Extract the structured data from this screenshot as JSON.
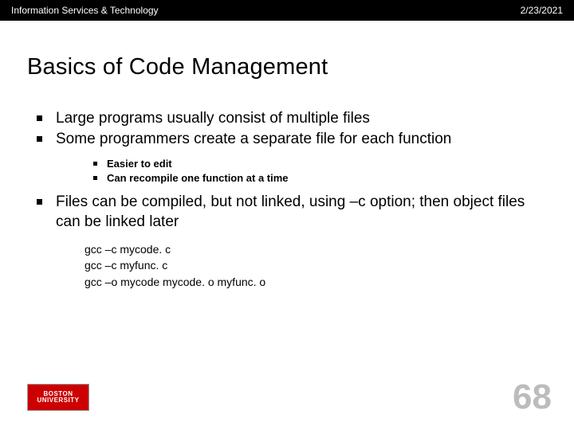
{
  "header": {
    "org": "Information Services & Technology",
    "date": "2/23/2021"
  },
  "title": "Basics of Code Management",
  "bullets": {
    "b1": "Large programs usually consist of multiple files",
    "b2": "Some programmers create a separate file for each function",
    "b2a": "Easier to edit",
    "b2b": "Can recompile one function at a time",
    "b3": "Files can be compiled, but not linked, using –c option; then object files can be linked later"
  },
  "code": {
    "l1": "gcc  –c  mycode. c",
    "l2": "gcc  –c  myfunc. c",
    "l3": "gcc  –o  mycode  mycode. o  myfunc. o"
  },
  "logo": {
    "line1": "BOSTON",
    "line2": "UNIVERSITY"
  },
  "page": "68"
}
